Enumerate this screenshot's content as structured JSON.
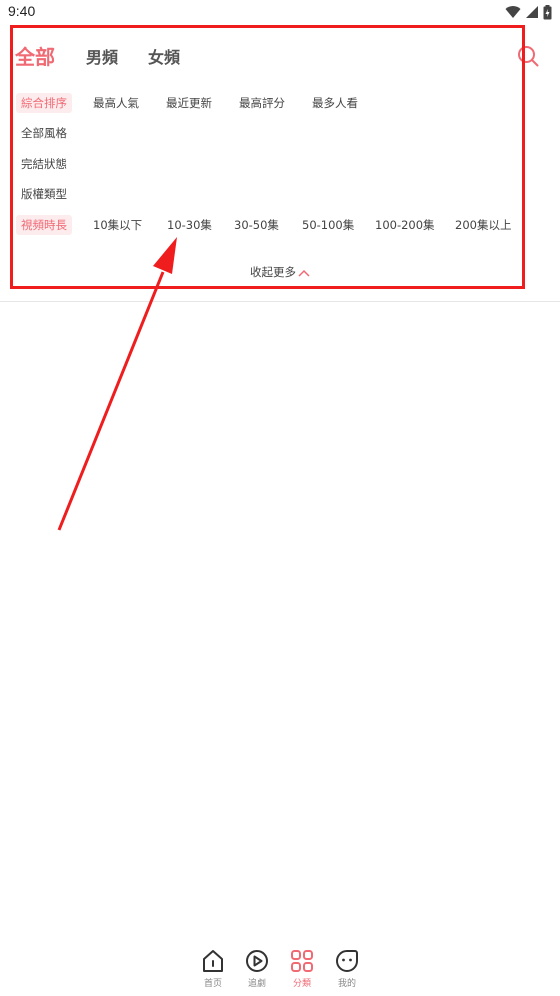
{
  "status_bar": {
    "time": "9:40"
  },
  "header": {
    "tabs": [
      {
        "label": "全部",
        "active": true
      },
      {
        "label": "男頻",
        "active": false
      },
      {
        "label": "女頻",
        "active": false
      }
    ],
    "search_icon": "search-icon"
  },
  "filters": {
    "sort": {
      "label": "綜合排序",
      "options": [
        "最高人氣",
        "最近更新",
        "最高評分",
        "最多人看"
      ]
    },
    "style": {
      "label": "全部風格"
    },
    "status": {
      "label": "完結狀態"
    },
    "copyright": {
      "label": "版權類型"
    },
    "length": {
      "label": "視頻時長",
      "options": [
        "10集以下",
        "10-30集",
        "30-50集",
        "50-100集",
        "100-200集",
        "200集以上"
      ]
    }
  },
  "collapse": {
    "label": "收起更多"
  },
  "bottom_nav": {
    "items": [
      {
        "label": "首页",
        "icon": "home-icon"
      },
      {
        "label": "追劇",
        "icon": "play-icon"
      },
      {
        "label": "分類",
        "icon": "grid-icon",
        "active": true
      },
      {
        "label": "我的",
        "icon": "profile-icon"
      }
    ]
  },
  "colors": {
    "accent": "#f06a74",
    "annotation": "#ef1d1d",
    "chip_bg": "#fdecee"
  }
}
